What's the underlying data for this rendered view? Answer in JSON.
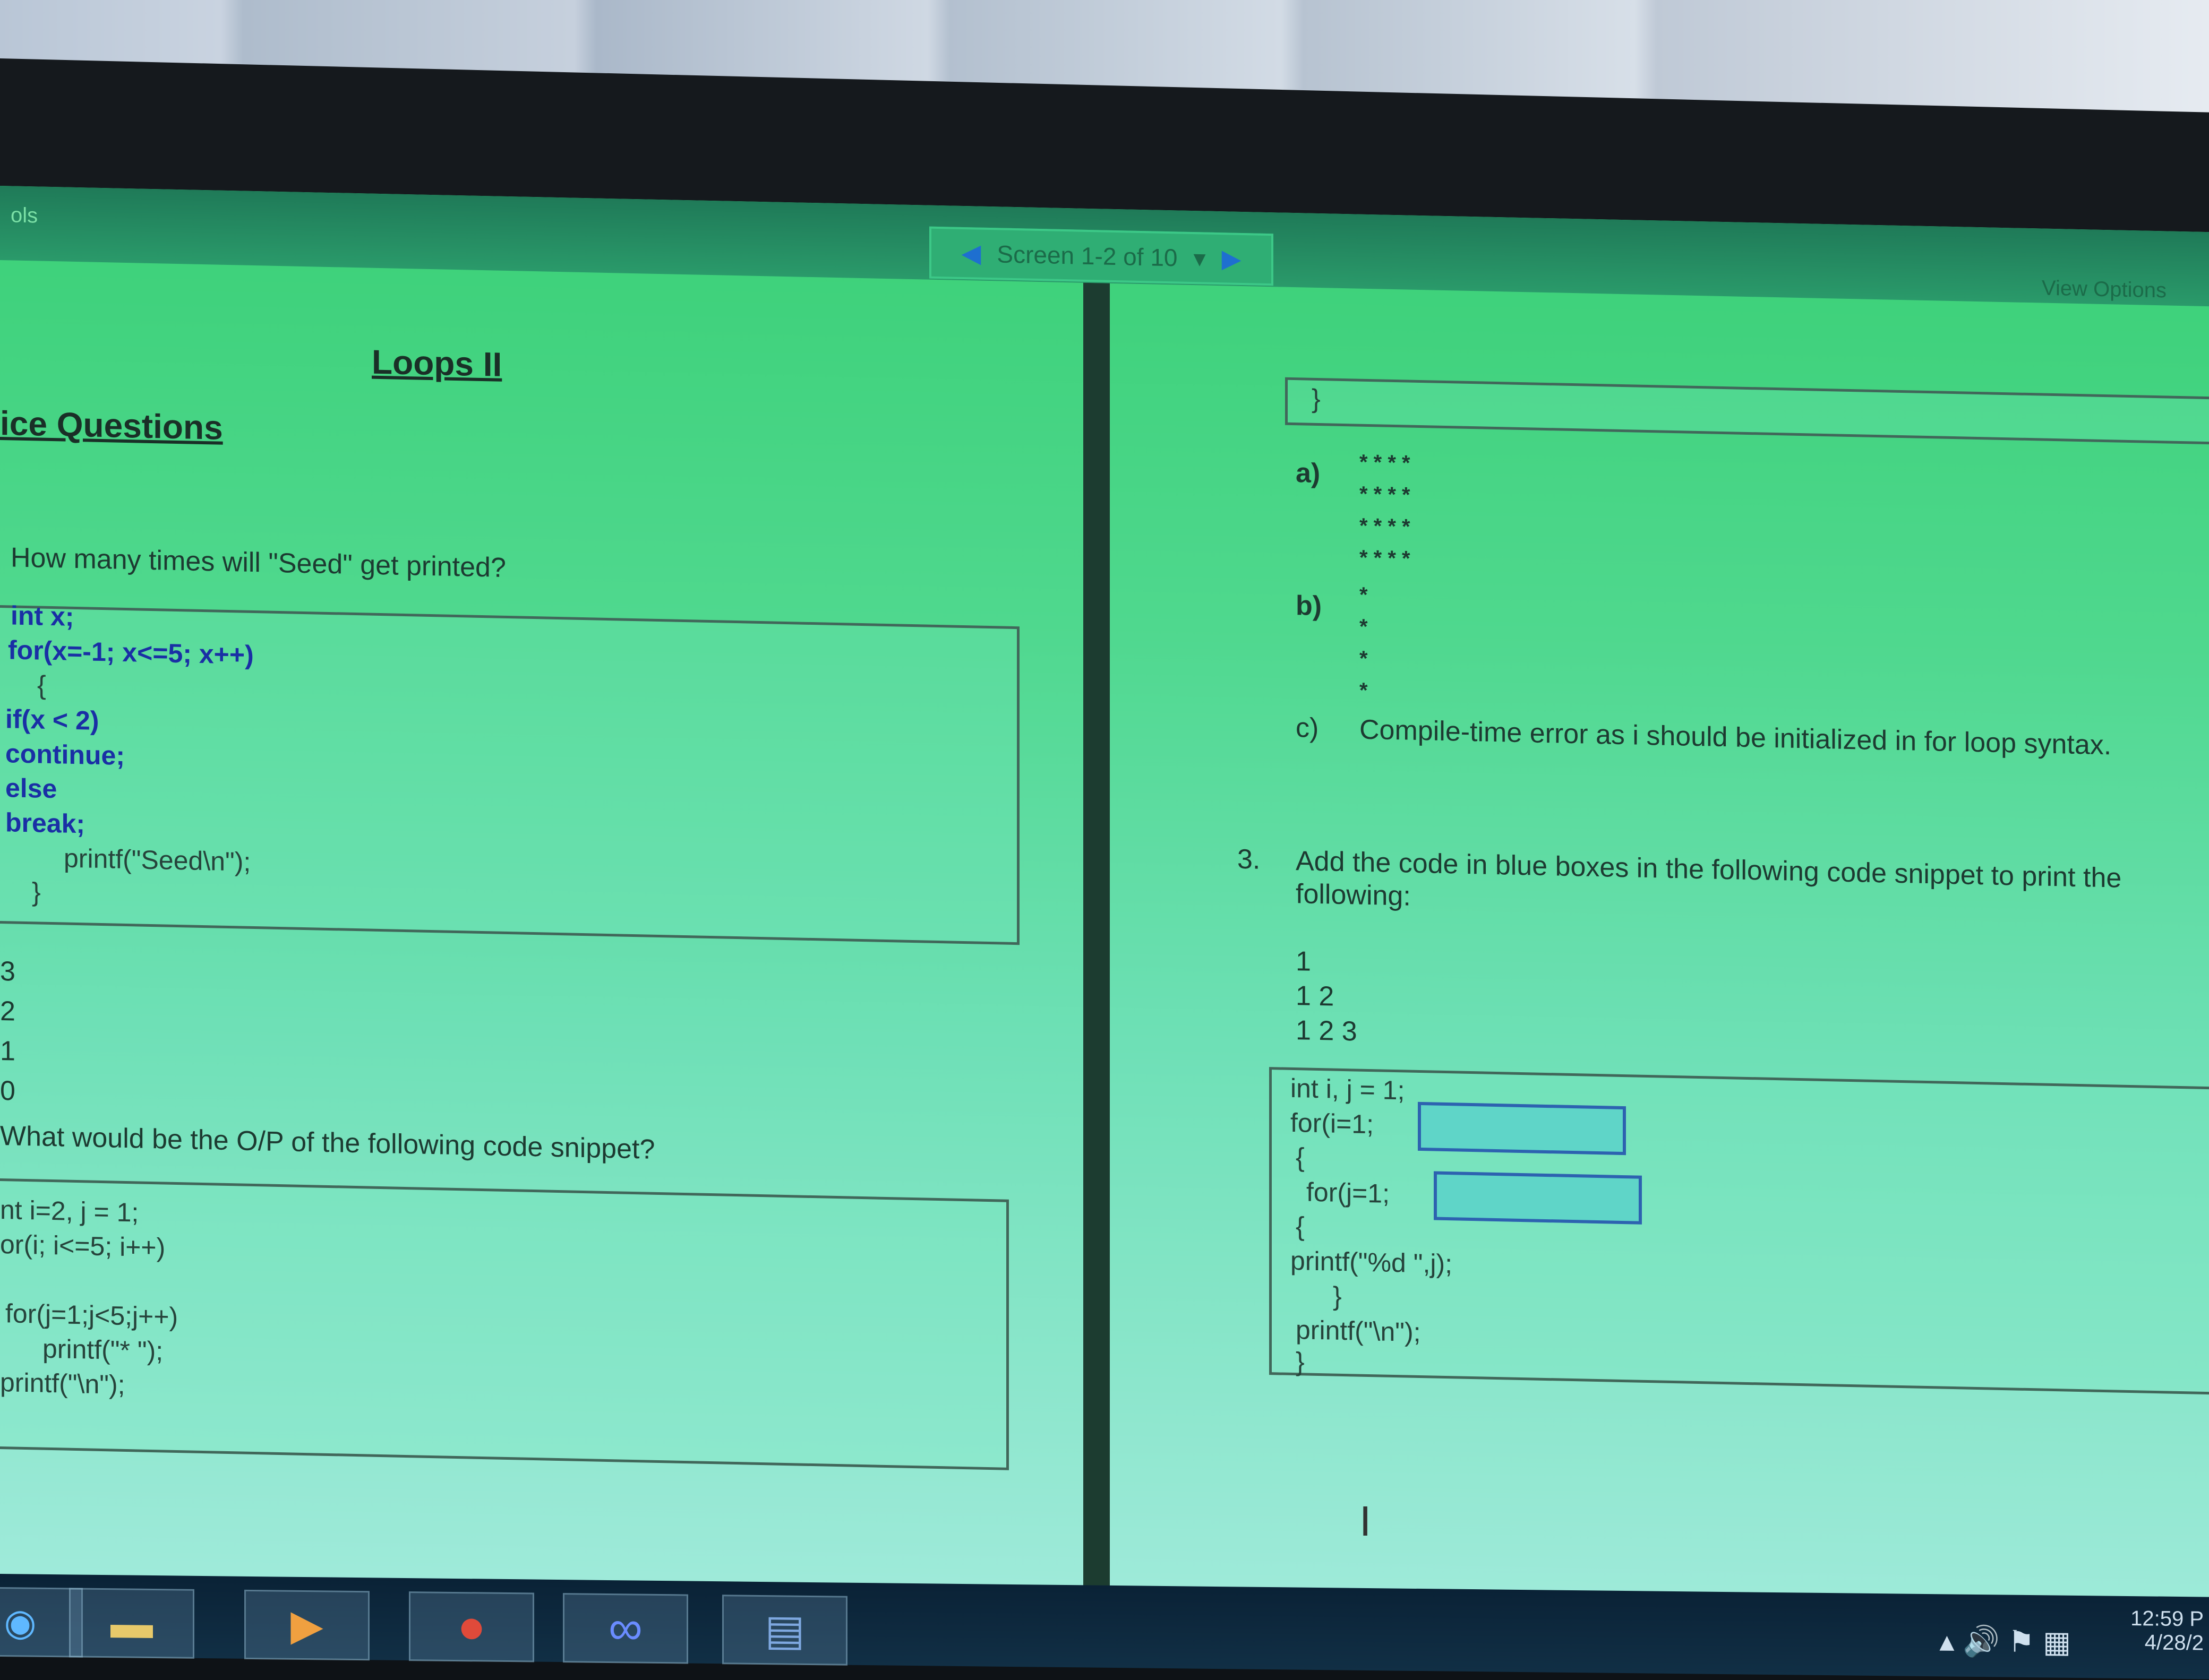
{
  "toolbar": {
    "tools_label": "ols",
    "pager_text": "Screen 1-2 of 10",
    "view_options": "View Options"
  },
  "left": {
    "title": "Loops II",
    "subtitle": "ice Questions",
    "q1": "How many times will \"Seed\" get printed?",
    "code1": [
      "int x;",
      "for(x=-1; x<=5; x++)",
      "{",
      "if(x < 2)",
      "continue;",
      "else",
      "break;",
      "printf(\"Seed\\n\");",
      "}"
    ],
    "options1": [
      "3",
      "2",
      "1",
      "0"
    ],
    "q2": "What would be the O/P of the following code snippet?",
    "code2": [
      "nt i=2, j = 1;",
      "or(i; i<=5; i++)",
      "",
      "for(j=1;j<5;j++)",
      "printf(\"* \");",
      "printf(\"\\n\");"
    ]
  },
  "right": {
    "brace": "}",
    "option_a": "a)",
    "option_a_rows": [
      "* * * *",
      "* * * *",
      "* * * *",
      "* * * *"
    ],
    "option_b": "b)",
    "option_b_rows": [
      "*",
      "*",
      "*",
      "*"
    ],
    "option_c": "c)",
    "option_c_text": "Compile-time error as i should be initialized in for loop syntax.",
    "q3_num": "3.",
    "q3_text": "Add the code in blue boxes in the following code snippet to print the following:",
    "q3_output": [
      "1",
      "1 2",
      "1 2 3"
    ],
    "code3": [
      "int i, j = 1;",
      "for(i=1;",
      "{",
      "for(j=1;",
      "{",
      "printf(\"%d \",j);",
      "}",
      "printf(\"\\n\");",
      "}"
    ]
  },
  "taskbar": {
    "time": "12:59 P",
    "date": "4/28/2"
  }
}
